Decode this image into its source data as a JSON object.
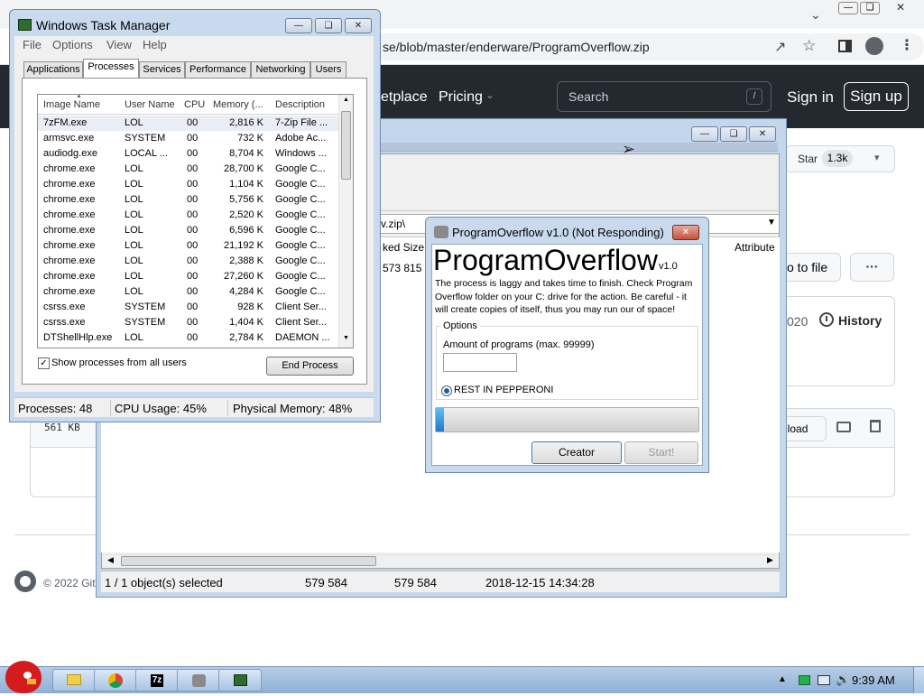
{
  "browser": {
    "url": "se/blob/master/enderware/ProgramOverflow.zip"
  },
  "github": {
    "nav_marketplace": "etplace",
    "nav_pricing": "Pricing",
    "search_placeholder": "Search",
    "search_shortcut": "/",
    "sign_in": "Sign in",
    "sign_up": "Sign up",
    "star_label": "Star",
    "star_count": "1.3k",
    "go_to_file": "o to file",
    "more": "···",
    "date_fragment": "020",
    "history": "History",
    "file_size": "561 KB",
    "download": "nload",
    "footer": "© 2022 Git"
  },
  "zip_window": {
    "path_fragment": "v.zip\\",
    "col_packed": "ked Size",
    "col_attr": "Attribute",
    "packed_value": "573 815",
    "status": {
      "selected": "1 / 1 object(s) selected",
      "size": "579 584",
      "packed": "579 584",
      "modified": "2018-12-15 14:34:28"
    }
  },
  "task_manager": {
    "title": "Windows Task Manager",
    "menu": [
      "File",
      "Options",
      "View",
      "Help"
    ],
    "tabs": [
      "Applications",
      "Processes",
      "Services",
      "Performance",
      "Networking",
      "Users"
    ],
    "active_tab": "Processes",
    "columns": [
      "Image Name",
      "User Name",
      "CPU",
      "Memory (...",
      "Description"
    ],
    "processes": [
      {
        "name": "7zFM.exe",
        "user": "LOL",
        "cpu": "00",
        "mem": "2,816 K",
        "desc": "7-Zip File ..."
      },
      {
        "name": "armsvc.exe",
        "user": "SYSTEM",
        "cpu": "00",
        "mem": "732 K",
        "desc": "Adobe Ac..."
      },
      {
        "name": "audiodg.exe",
        "user": "LOCAL ...",
        "cpu": "00",
        "mem": "8,704 K",
        "desc": "Windows ..."
      },
      {
        "name": "chrome.exe",
        "user": "LOL",
        "cpu": "00",
        "mem": "28,700 K",
        "desc": "Google C..."
      },
      {
        "name": "chrome.exe",
        "user": "LOL",
        "cpu": "00",
        "mem": "1,104 K",
        "desc": "Google C..."
      },
      {
        "name": "chrome.exe",
        "user": "LOL",
        "cpu": "00",
        "mem": "5,756 K",
        "desc": "Google C..."
      },
      {
        "name": "chrome.exe",
        "user": "LOL",
        "cpu": "00",
        "mem": "2,520 K",
        "desc": "Google C..."
      },
      {
        "name": "chrome.exe",
        "user": "LOL",
        "cpu": "00",
        "mem": "6,596 K",
        "desc": "Google C..."
      },
      {
        "name": "chrome.exe",
        "user": "LOL",
        "cpu": "00",
        "mem": "21,192 K",
        "desc": "Google C..."
      },
      {
        "name": "chrome.exe",
        "user": "LOL",
        "cpu": "00",
        "mem": "2,388 K",
        "desc": "Google C..."
      },
      {
        "name": "chrome.exe",
        "user": "LOL",
        "cpu": "00",
        "mem": "27,260 K",
        "desc": "Google C..."
      },
      {
        "name": "chrome.exe",
        "user": "LOL",
        "cpu": "00",
        "mem": "4,284 K",
        "desc": "Google C..."
      },
      {
        "name": "csrss.exe",
        "user": "SYSTEM",
        "cpu": "00",
        "mem": "928 K",
        "desc": "Client Ser..."
      },
      {
        "name": "csrss.exe",
        "user": "SYSTEM",
        "cpu": "00",
        "mem": "1,404 K",
        "desc": "Client Ser..."
      },
      {
        "name": "DTShellHlp.exe",
        "user": "LOL",
        "cpu": "00",
        "mem": "2,784 K",
        "desc": "DAEMON ..."
      }
    ],
    "show_all_users": "Show processes from all users",
    "end_process": "End Process",
    "status": {
      "processes": "Processes: 48",
      "cpu": "CPU Usage: 45%",
      "memory": "Physical Memory: 48%"
    }
  },
  "program_overflow": {
    "title": "ProgramOverflow v1.0 (Not Responding)",
    "heading": "ProgramOverflow",
    "version": "v1.0",
    "description": "The process is laggy and takes time to finish. Check Program Overflow folder on your C: drive for the action. Be careful - it will create copies of itself, thus you may run our of space!",
    "options_label": "Options",
    "amount_label": "Amount of programs (max. 99999)",
    "amount_value": "",
    "radio_label": "REST IN PEPPERONI",
    "progress": 0.03,
    "creator_button": "Creator",
    "start_button": "Start!"
  },
  "taskbar": {
    "clock": "9:39 AM",
    "seven_zip": "7z"
  },
  "colors": {
    "github_nav": "#24292f",
    "progress_fill": "#1f78c8"
  }
}
